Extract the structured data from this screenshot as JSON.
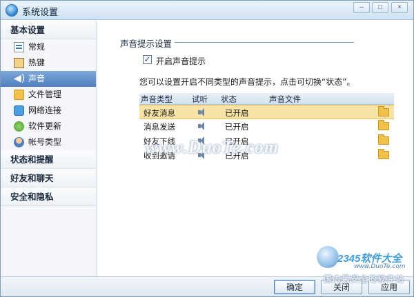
{
  "window": {
    "title": "系统设置",
    "controls": {
      "minimize": "–",
      "maximize": "□",
      "close": "×"
    }
  },
  "sidebar": {
    "groups": [
      {
        "label": "基本设置",
        "items": [
          {
            "label": "常规",
            "icon": "general-icon"
          },
          {
            "label": "热键",
            "icon": "hotkey-icon"
          },
          {
            "label": "声音",
            "icon": "speaker-icon",
            "selected": true
          },
          {
            "label": "文件管理",
            "icon": "folder-icon"
          },
          {
            "label": "网络连接",
            "icon": "network-icon"
          },
          {
            "label": "软件更新",
            "icon": "update-icon"
          },
          {
            "label": "帐号类型",
            "icon": "account-icon"
          }
        ]
      },
      {
        "label": "状态和提醒"
      },
      {
        "label": "好友和聊天"
      },
      {
        "label": "安全和隐私"
      }
    ]
  },
  "main": {
    "section_title": "声音提示设置",
    "enable_checkbox": {
      "label": "开启声音提示",
      "checked": true,
      "mark": "✓"
    },
    "hint": "您可以设置开启不同类型的声音提示，点击可切换“状态”。",
    "table": {
      "headers": [
        "声音类型",
        "试听",
        "状态",
        "声音文件"
      ],
      "rows": [
        {
          "type": "好友消息",
          "status": "已开启",
          "selected": true
        },
        {
          "type": "消息发送",
          "status": "已开启"
        },
        {
          "type": "好友下线",
          "status": "已开启"
        },
        {
          "type": "收到邀请",
          "status": "已开启"
        }
      ]
    }
  },
  "buttons": {
    "ok": "确定",
    "close": "关闭",
    "apply": "应用"
  },
  "watermarks": {
    "center": "www.DuoTe.com",
    "brand": "2345软件大全",
    "url": "www.DuoTe.com",
    "slogan": "国内最安全的软件站"
  },
  "colors": {
    "accent": "#4f7fbf",
    "selected_row": "#f7e3a6",
    "title_bar": "#cfe2f3"
  }
}
